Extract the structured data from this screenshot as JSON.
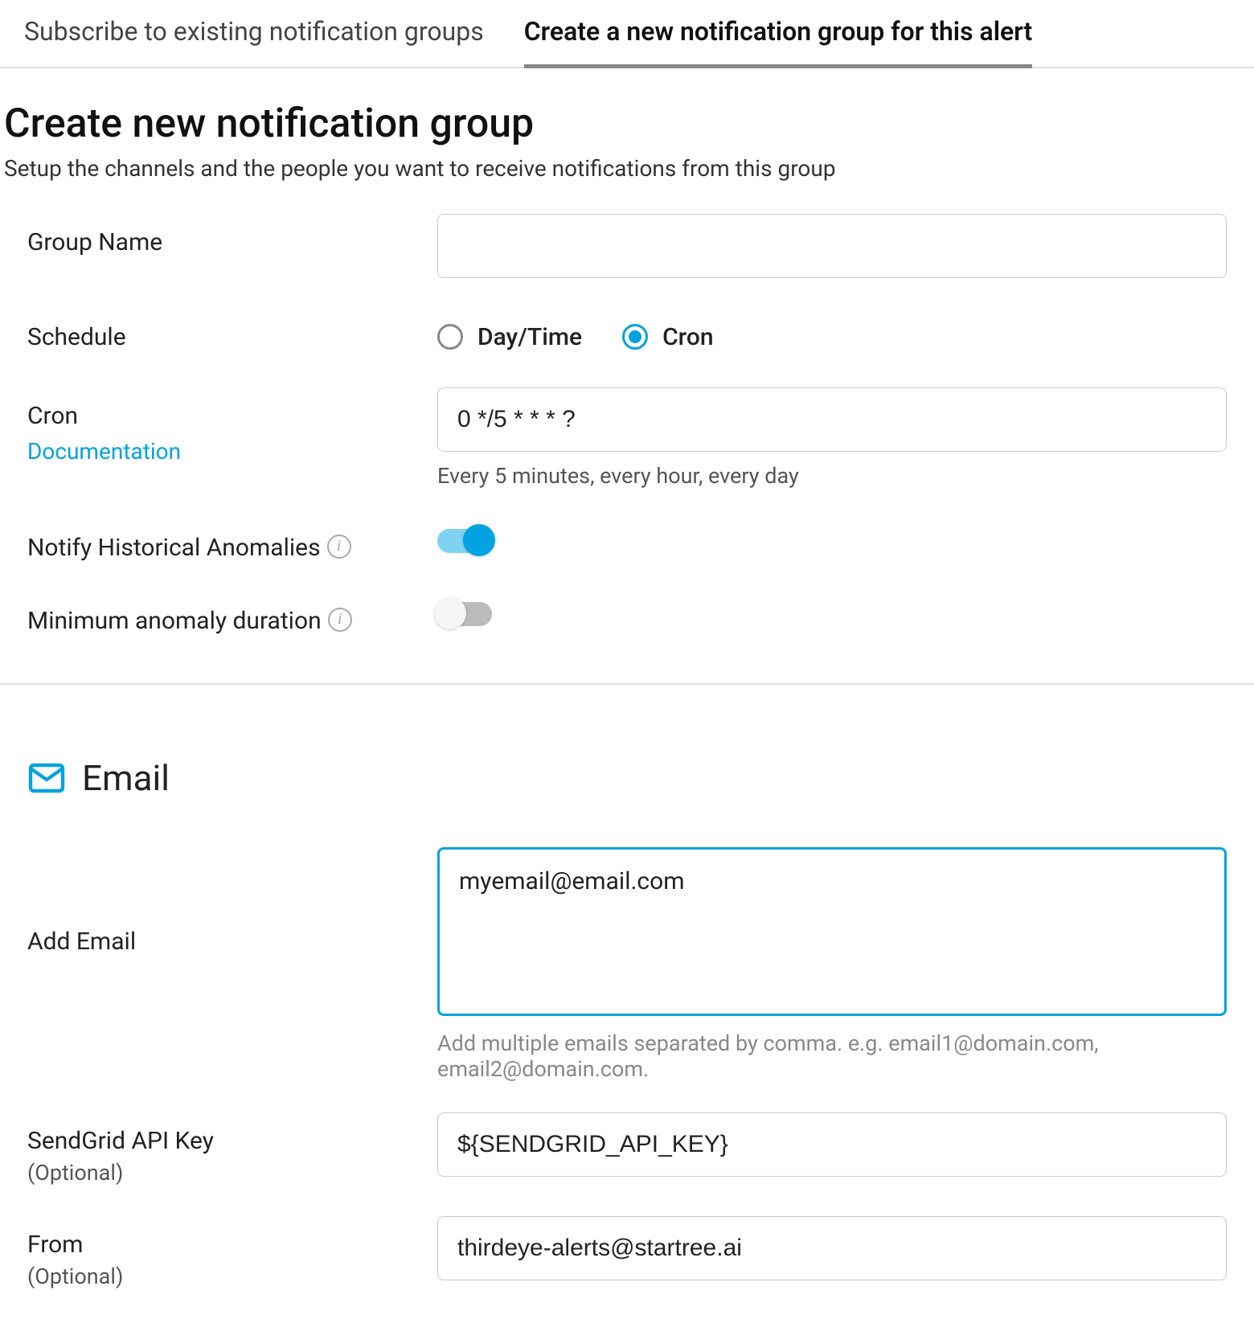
{
  "tabs": {
    "subscribe": "Subscribe to existing notification groups",
    "create": "Create a new notification group for this alert"
  },
  "header": {
    "title": "Create new notification group",
    "subtitle": "Setup the channels and the people you want to receive notifications from this group"
  },
  "form": {
    "group_name_label": "Group Name",
    "group_name_value": "",
    "schedule_label": "Schedule",
    "schedule_options": {
      "daytime": "Day/Time",
      "cron": "Cron"
    },
    "schedule_selected": "cron",
    "cron_label": "Cron",
    "cron_doc_link": "Documentation",
    "cron_value": "0 */5 * * * ?",
    "cron_description": "Every 5 minutes, every hour, every day",
    "notify_historical_label": "Notify Historical Anomalies",
    "notify_historical_value": true,
    "min_duration_label": "Minimum anomaly duration",
    "min_duration_value": false
  },
  "email_section": {
    "title": "Email",
    "add_email_label": "Add Email",
    "add_email_value": "myemail@email.com",
    "add_email_helper": "Add multiple emails separated by comma. e.g. email1@domain.com, email2@domain.com.",
    "sendgrid_label": "SendGrid API Key",
    "sendgrid_optional": "(Optional)",
    "sendgrid_value": "${SENDGRID_API_KEY}",
    "from_label": "From",
    "from_optional": "(Optional)",
    "from_value": "thirdeye-alerts@startree.ai"
  }
}
